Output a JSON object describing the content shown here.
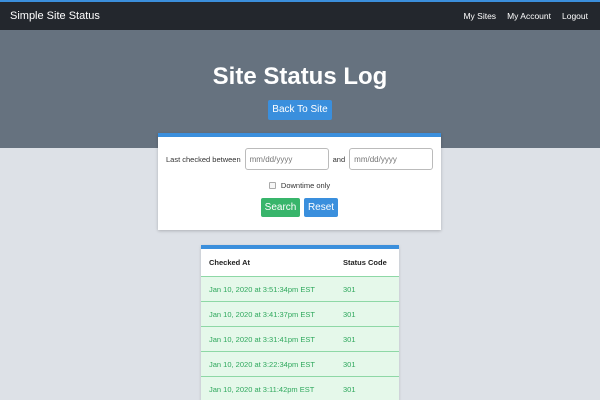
{
  "app": {
    "brand": "Simple Site Status"
  },
  "nav": {
    "items": [
      {
        "label": "My Sites"
      },
      {
        "label": "My Account"
      },
      {
        "label": "Logout"
      }
    ]
  },
  "header": {
    "title": "Site Status Log",
    "back_label": "Back To Site"
  },
  "filter": {
    "between_label": "Last checked between",
    "start_placeholder": "mm/dd/yyyy",
    "and_label": "and",
    "end_placeholder": "mm/dd/yyyy",
    "downtime_label": "Downtime only",
    "downtime_checked": false,
    "search_label": "Search",
    "reset_label": "Reset"
  },
  "log": {
    "columns": [
      "Checked At",
      "Status Code"
    ],
    "rows": [
      {
        "checked_at": "Jan 10, 2020 at 3:51:34pm EST",
        "status": "301"
      },
      {
        "checked_at": "Jan 10, 2020 at 3:41:37pm EST",
        "status": "301"
      },
      {
        "checked_at": "Jan 10, 2020 at 3:31:41pm EST",
        "status": "301"
      },
      {
        "checked_at": "Jan 10, 2020 at 3:22:34pm EST",
        "status": "301"
      },
      {
        "checked_at": "Jan 10, 2020 at 3:11:42pm EST",
        "status": "301"
      }
    ]
  },
  "colors": {
    "topbar": "#23272d",
    "accent": "#3b8fdc",
    "hero": "#66727f",
    "success": "#38b56b",
    "row_bg": "#e5f8ea",
    "row_text": "#2fa85d"
  }
}
